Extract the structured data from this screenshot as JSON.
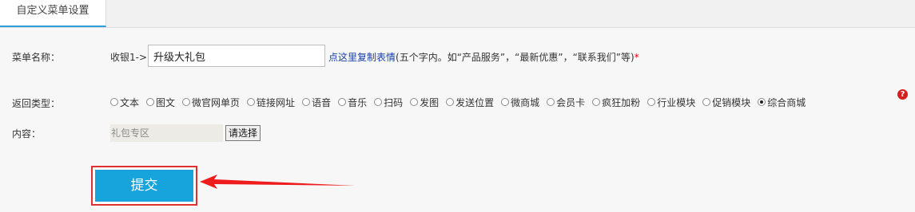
{
  "tab": {
    "label": "自定义菜单设置"
  },
  "name_row": {
    "label": "菜单名称：",
    "prefix": "收银1->",
    "input_value": "升级大礼包",
    "link_text": "点这里复制表情",
    "hint_text": "(五个字内。如“产品服务”，“最新优惠”，“联系我们”等)",
    "required_mark": "*"
  },
  "type_row": {
    "label": "返回类型：",
    "options": [
      {
        "label": "文本",
        "checked": false
      },
      {
        "label": "图文",
        "checked": false
      },
      {
        "label": "微官网单页",
        "checked": false
      },
      {
        "label": "链接网址",
        "checked": false
      },
      {
        "label": "语音",
        "checked": false
      },
      {
        "label": "音乐",
        "checked": false
      },
      {
        "label": "扫码",
        "checked": false
      },
      {
        "label": "发图",
        "checked": false
      },
      {
        "label": "发送位置",
        "checked": false
      },
      {
        "label": "微商城",
        "checked": false
      },
      {
        "label": "会员卡",
        "checked": false
      },
      {
        "label": "疯狂加粉",
        "checked": false
      },
      {
        "label": "行业模块",
        "checked": false
      },
      {
        "label": "促销模块",
        "checked": false
      },
      {
        "label": "综合商城",
        "checked": true
      }
    ],
    "help_glyph": "?"
  },
  "content_row": {
    "label": "内容：",
    "value": "礼包专区",
    "choose_label": "请选择"
  },
  "submit": {
    "label": "提交"
  },
  "colors": {
    "accent": "#17a3dc",
    "highlight": "#e03030",
    "link": "#1a3fa8"
  }
}
